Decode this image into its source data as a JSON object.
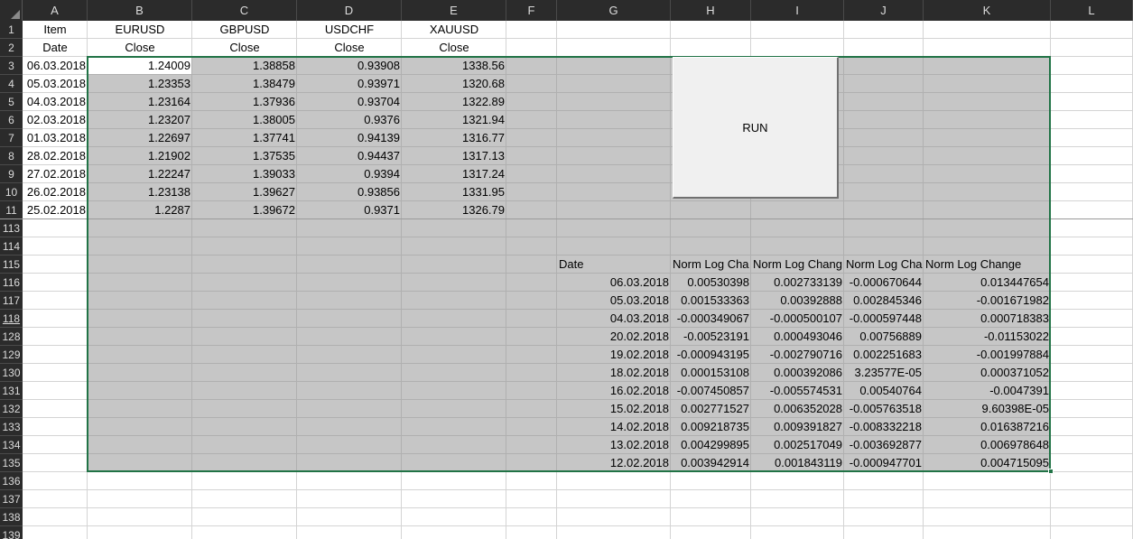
{
  "columns": [
    "A",
    "B",
    "C",
    "D",
    "E",
    "F",
    "G",
    "H",
    "I",
    "J",
    "K",
    "L"
  ],
  "row_numbers": [
    "1",
    "2",
    "3",
    "4",
    "5",
    "6",
    "7",
    "8",
    "9",
    "10",
    "11",
    "113",
    "114",
    "115",
    "116",
    "117",
    "118",
    "128",
    "129",
    "130",
    "131",
    "132",
    "133",
    "134",
    "135",
    "136",
    "137",
    "138",
    "139"
  ],
  "top_table": {
    "header1": [
      "Item",
      "EURUSD",
      "GBPUSD",
      "USDCHF",
      "XAUUSD"
    ],
    "header2": [
      "Date",
      "Close",
      "Close",
      "Close",
      "Close"
    ],
    "rows": [
      [
        "06.03.2018",
        "1.24009",
        "1.38858",
        "0.93908",
        "1338.56"
      ],
      [
        "05.03.2018",
        "1.23353",
        "1.38479",
        "0.93971",
        "1320.68"
      ],
      [
        "04.03.2018",
        "1.23164",
        "1.37936",
        "0.93704",
        "1322.89"
      ],
      [
        "02.03.2018",
        "1.23207",
        "1.38005",
        "0.9376",
        "1321.94"
      ],
      [
        "01.03.2018",
        "1.22697",
        "1.37741",
        "0.94139",
        "1316.77"
      ],
      [
        "28.02.2018",
        "1.21902",
        "1.37535",
        "0.94437",
        "1317.13"
      ],
      [
        "27.02.2018",
        "1.22247",
        "1.39033",
        "0.9394",
        "1317.24"
      ],
      [
        "26.02.2018",
        "1.23138",
        "1.39627",
        "0.93856",
        "1331.95"
      ],
      [
        "25.02.2018",
        "1.2287",
        "1.39672",
        "0.9371",
        "1326.79"
      ]
    ]
  },
  "run_button": {
    "label": "RUN"
  },
  "bottom_table": {
    "headers": [
      "Date",
      "Norm Log Cha",
      "Norm Log Chang",
      "Norm Log Cha",
      "Norm Log Change"
    ],
    "rows": [
      [
        "06.03.2018",
        "0.00530398",
        "0.002733139",
        "-0.000670644",
        "0.013447654"
      ],
      [
        "05.03.2018",
        "0.001533363",
        "0.00392888",
        "0.002845346",
        "-0.001671982"
      ],
      [
        "04.03.2018",
        "-0.000349067",
        "-0.000500107",
        "-0.000597448",
        "0.000718383"
      ],
      [
        "20.02.2018",
        "-0.00523191",
        "0.000493046",
        "0.00756889",
        "-0.01153022"
      ],
      [
        "19.02.2018",
        "-0.000943195",
        "-0.002790716",
        "0.002251683",
        "-0.001997884"
      ],
      [
        "18.02.2018",
        "0.000153108",
        "0.000392086",
        "3.23577E-05",
        "0.000371052"
      ],
      [
        "16.02.2018",
        "-0.007450857",
        "-0.005574531",
        "0.00540764",
        "-0.0047391"
      ],
      [
        "15.02.2018",
        "0.002771527",
        "0.006352028",
        "-0.005763518",
        "9.60398E-05"
      ],
      [
        "14.02.2018",
        "0.009218735",
        "0.009391827",
        "-0.008332218",
        "0.016387216"
      ],
      [
        "13.02.2018",
        "0.004299895",
        "0.002517049",
        "-0.003692877",
        "0.006978648"
      ],
      [
        "12.02.2018",
        "0.003942914",
        "0.001843119",
        "-0.000947701",
        "0.004715095"
      ]
    ]
  },
  "colors": {
    "selection": "#217346",
    "header_bg": "#2b2b2b",
    "selected_fill": "#c6c6c6"
  }
}
